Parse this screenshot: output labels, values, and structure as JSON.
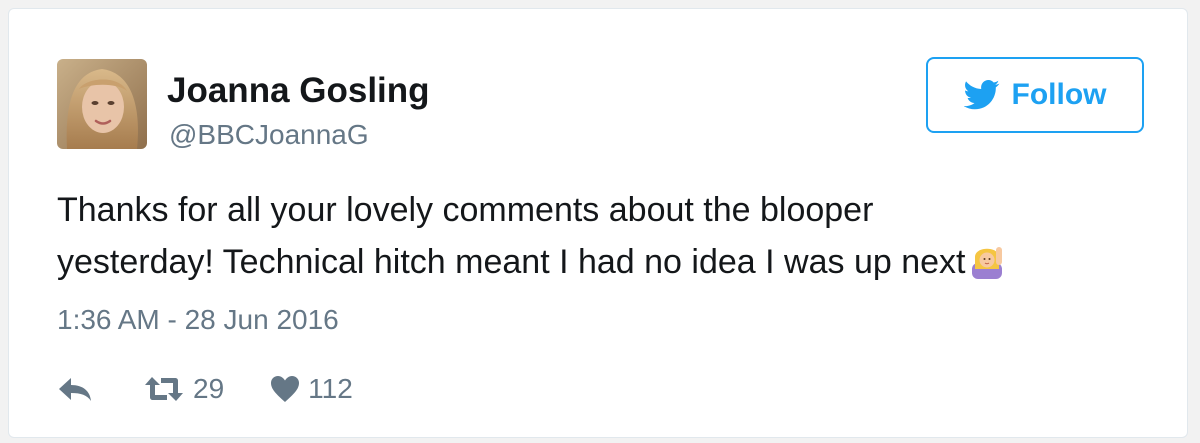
{
  "user": {
    "display_name": "Joanna Gosling",
    "handle": "@BBCJoannaG"
  },
  "follow_button": {
    "label": "Follow"
  },
  "tweet": {
    "text_line1": "Thanks for all your lovely comments about the blooper",
    "text_line2": "yesterday! Technical hitch meant I had no idea I was up next",
    "emoji": "person-raising-hand-emoji",
    "timestamp": "1:36 AM - 28 Jun 2016"
  },
  "actions": {
    "reply_icon": "reply-icon",
    "retweet_icon": "retweet-icon",
    "retweet_count": "29",
    "like_icon": "heart-icon",
    "like_count": "112"
  },
  "colors": {
    "accent": "#1da1f2",
    "text": "#14171a",
    "muted": "#657786",
    "border": "#e1e8ed"
  }
}
